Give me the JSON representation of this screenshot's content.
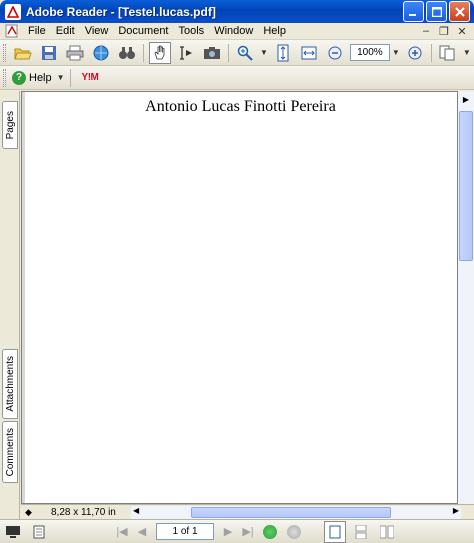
{
  "window": {
    "title": "Adobe Reader - [Testel.lucas.pdf]"
  },
  "menu": {
    "items": [
      "File",
      "Edit",
      "View",
      "Document",
      "Tools",
      "Window",
      "Help"
    ]
  },
  "toolbar": {
    "zoom_value": "100%",
    "help_label": "Help",
    "yahoo_label": "Y!M"
  },
  "nav_tabs": {
    "pages": "Pages",
    "attachments": "Attachments",
    "comments": "Comments"
  },
  "document": {
    "heading": "Antonio Lucas Finotti Pereira"
  },
  "infobar": {
    "page_size": "8,28 x 11,70 in"
  },
  "statusbar": {
    "page_indicator": "1 of 1"
  },
  "colors": {
    "titlebar": "#0a5fd8",
    "close_button": "#c8401c",
    "help_green": "#2f9e3a"
  }
}
